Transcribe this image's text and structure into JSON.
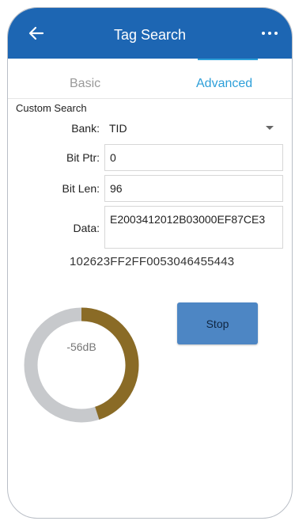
{
  "header": {
    "title": "Tag Search",
    "back_icon": "arrow-left-icon",
    "more_icon": "more-horizontal-icon"
  },
  "tabs": [
    {
      "label": "Basic",
      "active": false
    },
    {
      "label": "Advanced",
      "active": true
    }
  ],
  "form": {
    "section_label": "Custom Search",
    "bank": {
      "label": "Bank:",
      "value": "TID"
    },
    "bit_ptr": {
      "label": "Bit Ptr:",
      "value": "0"
    },
    "bit_len": {
      "label": "Bit Len:",
      "value": "96"
    },
    "data": {
      "label": "Data:",
      "value": "E2003412012B03000EF87CE3"
    }
  },
  "result": {
    "tag_id": "102623FF2FF0053046455443",
    "signal": "-56dB",
    "signal_level_percent": 45
  },
  "actions": {
    "stop_label": "Stop"
  },
  "colors": {
    "appbar": "#1d66b3",
    "accent": "#2d9fd9",
    "gauge_fill": "#8a6b26",
    "gauge_track": "#c7c9cc",
    "button": "#4d86c4"
  }
}
